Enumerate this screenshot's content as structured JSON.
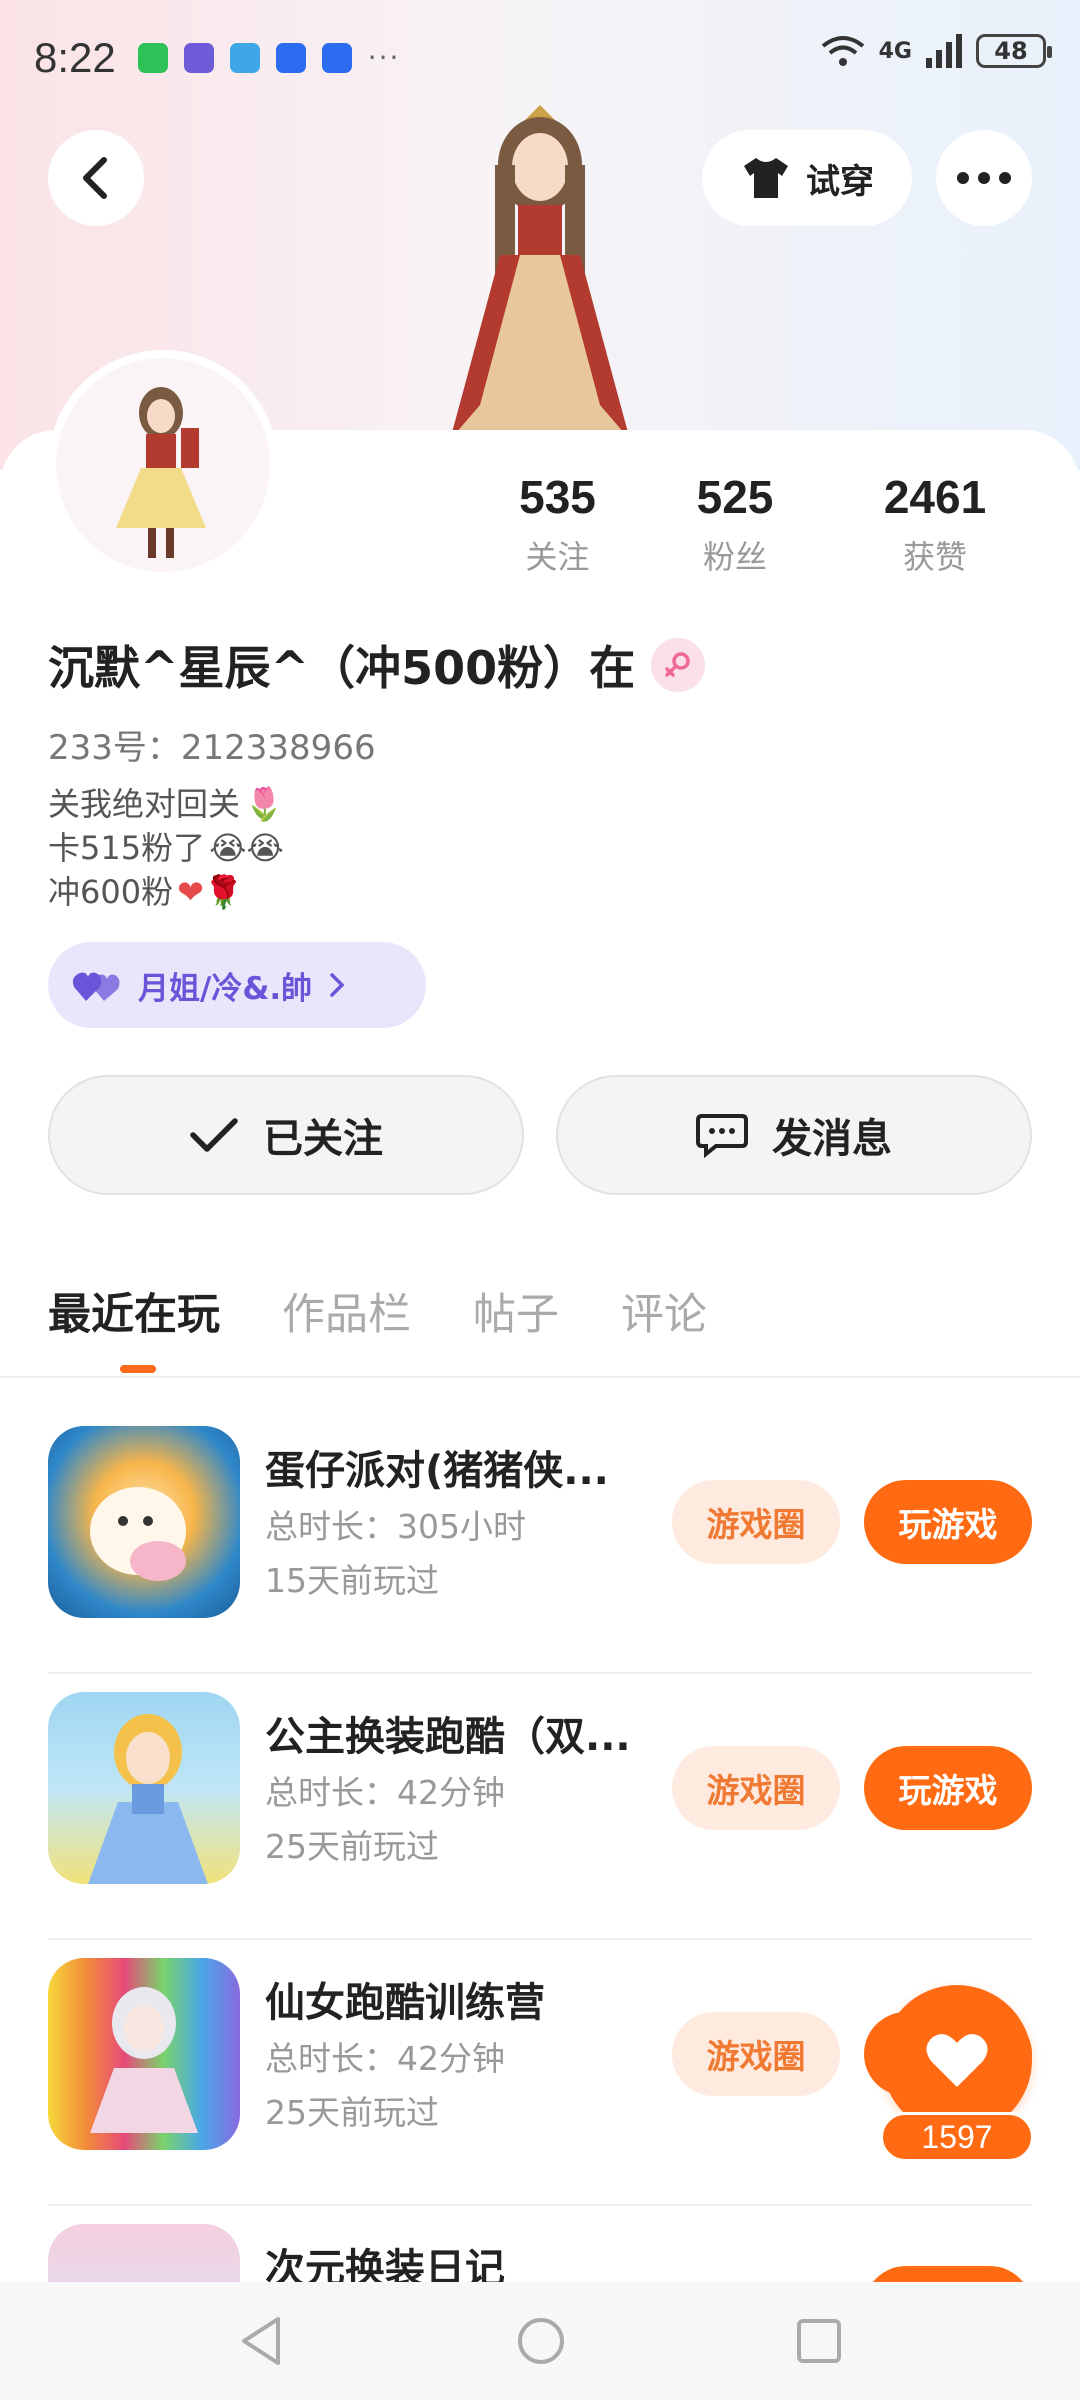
{
  "status_bar": {
    "time": "8:22",
    "network": "4G",
    "battery": "48",
    "more": "···"
  },
  "header": {
    "tryon_label": "试穿"
  },
  "profile": {
    "stats": [
      {
        "num": "535",
        "label": "关注"
      },
      {
        "num": "525",
        "label": "粉丝"
      },
      {
        "num": "2461",
        "label": "获赞"
      }
    ],
    "name": "沉默^星辰^（冲500粉）在",
    "uid": "233号：212338966",
    "bio": [
      "关我绝对回关",
      "卡515粉了",
      "冲600粉"
    ],
    "relation": "月姐/冷&.帥"
  },
  "actions": {
    "follow_label": "已关注",
    "message_label": "发消息"
  },
  "tabs": [
    "最近在玩",
    "作品栏",
    "帖子",
    "评论"
  ],
  "games": [
    {
      "title": "蛋仔派对(猪猪侠...",
      "duration": "总时长：305小时",
      "last_played": "15天前玩过",
      "circle_label": "游戏圈",
      "play_label": "玩游戏"
    },
    {
      "title": "公主换装跑酷（双...",
      "duration": "总时长：42分钟",
      "last_played": "25天前玩过",
      "circle_label": "游戏圈",
      "play_label": "玩游戏"
    },
    {
      "title": "仙女跑酷训练营",
      "duration": "总时长：42分钟",
      "last_played": "25天前玩过",
      "circle_label": "游戏圈",
      "play_label": "玩游戏"
    },
    {
      "title": "次元换装日记",
      "duration": "",
      "last_played": "",
      "circle_label": "",
      "play_label": ""
    }
  ],
  "like_fab": {
    "count": "1597"
  },
  "colors": {
    "accent": "#ff6a12",
    "relation": "#6a55d8"
  }
}
